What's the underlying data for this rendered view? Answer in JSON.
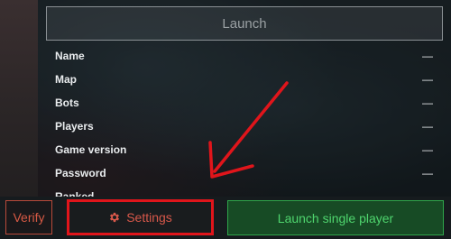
{
  "launch_button": {
    "label": "Launch"
  },
  "server_info": [
    {
      "label": "Name",
      "value": "—"
    },
    {
      "label": "Map",
      "value": "—"
    },
    {
      "label": "Bots",
      "value": "—"
    },
    {
      "label": "Players",
      "value": "—"
    },
    {
      "label": "Game version",
      "value": "—"
    },
    {
      "label": "Password",
      "value": "—"
    },
    {
      "label": "Ranked",
      "value": "—"
    }
  ],
  "bottom_bar": {
    "verify_label": "Verify",
    "settings_label": "Settings",
    "single_player_label": "Launch single player"
  },
  "icons": {
    "settings": "gear-icon"
  },
  "colors": {
    "annotation": "#e0151b",
    "verify_accent": "#d85a45",
    "single_player_accent": "#4fd56e",
    "single_player_bg": "#174b25"
  }
}
